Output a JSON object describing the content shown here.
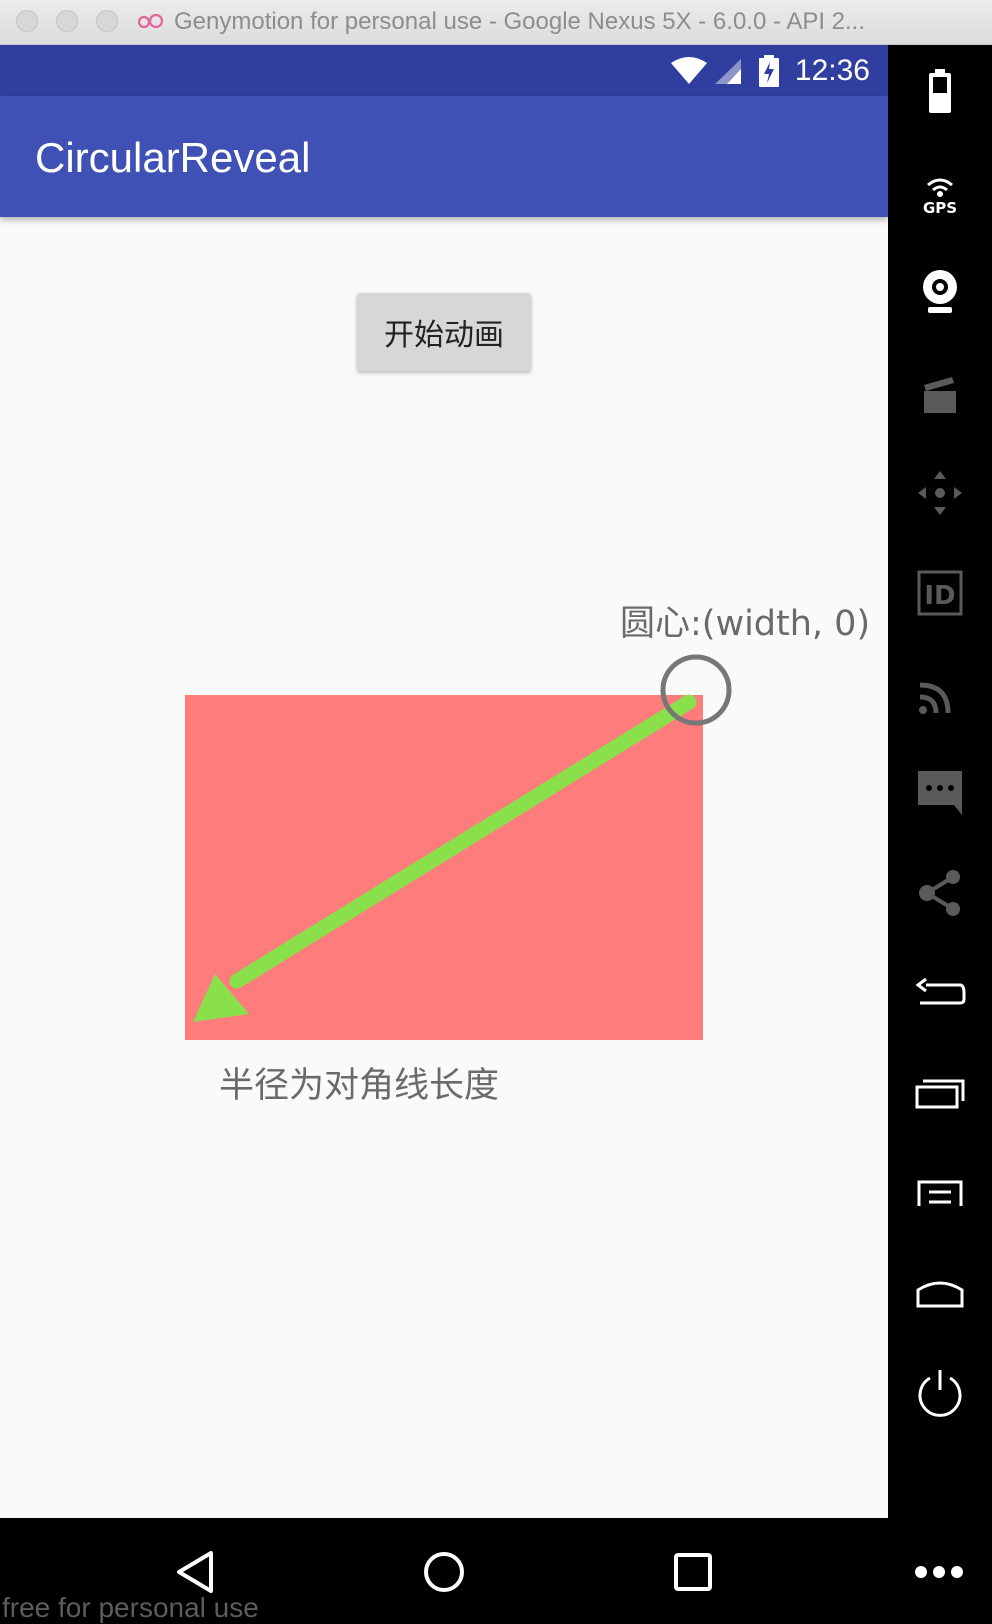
{
  "window": {
    "title": "Genymotion for personal use - Google Nexus 5X - 6.0.0 - API 2..."
  },
  "statusbar": {
    "time": "12:36"
  },
  "app": {
    "title": "CircularReveal",
    "start_button_label": "开始动画",
    "center_label": "圆心:(width, 0)",
    "radius_label": "半径为对角线长度"
  },
  "colors": {
    "status_bar": "#303f9f",
    "app_bar": "#3f51b5",
    "reveal_box": "#fe7c7c",
    "arrow": "#8ae04a",
    "circle_marker": "#777777"
  },
  "toolbar": {
    "items": [
      "battery-icon",
      "gps-icon",
      "webcam-icon",
      "capture-icon",
      "dpad-icon",
      "device-id-icon",
      "cast-icon",
      "sms-icon",
      "share-icon",
      "back-icon",
      "recent-apps-icon",
      "menu-icon",
      "home-icon",
      "power-icon"
    ]
  },
  "navbar": {
    "items": [
      "back-triangle-icon",
      "home-circle-icon",
      "overview-square-icon",
      "more-icon"
    ],
    "watermark": "free for personal use"
  }
}
